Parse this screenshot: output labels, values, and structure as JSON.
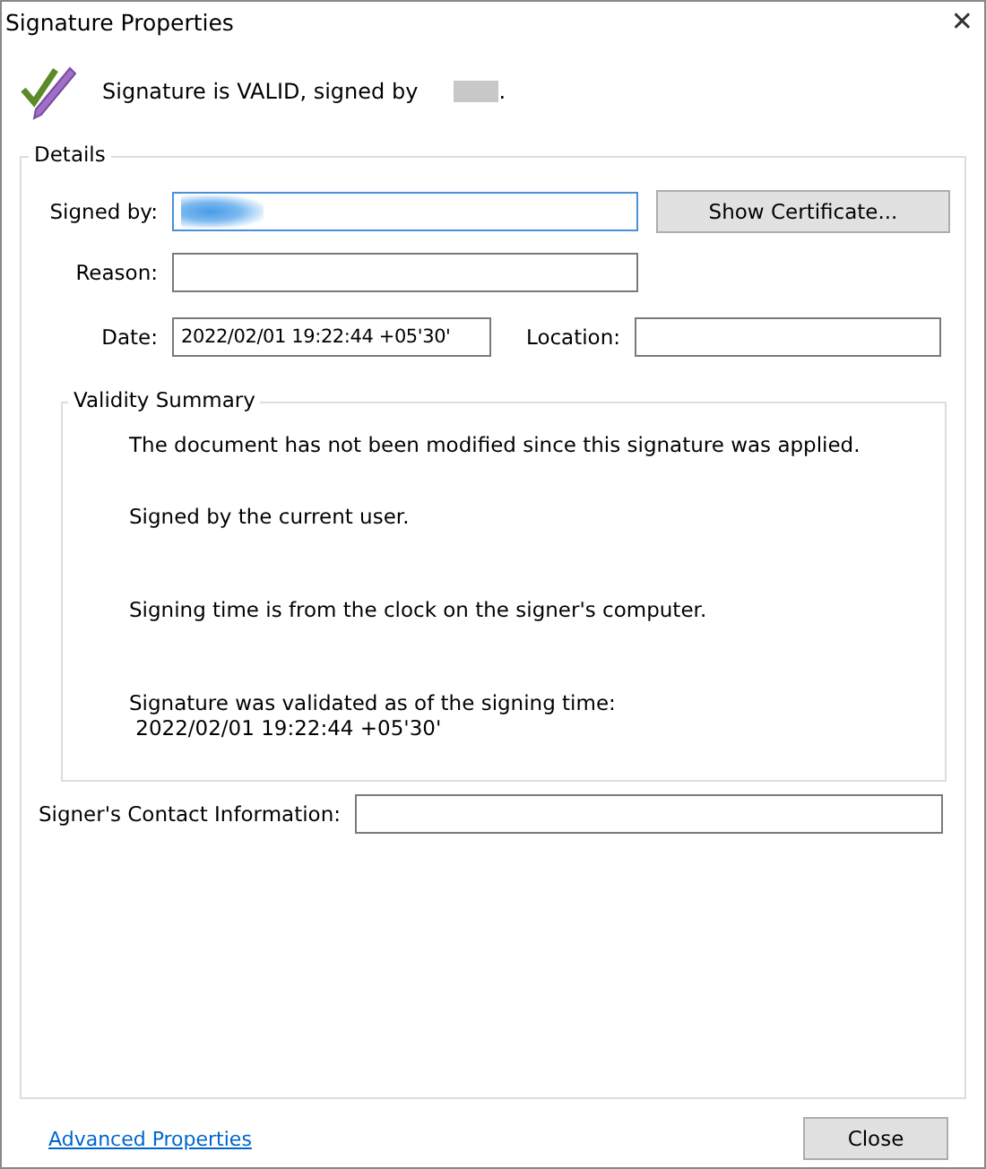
{
  "window": {
    "title": "Signature Properties",
    "close_glyph": "✕"
  },
  "header": {
    "message": "Signature is VALID, signed by",
    "message_end": "."
  },
  "details": {
    "title": "Details",
    "signed_by": {
      "label": "Signed by:",
      "focused": true
    },
    "show_certificate": "Show Certificate...",
    "reason": {
      "label": "Reason:",
      "focused": false
    },
    "date": {
      "label": "Date:",
      "value": "2022/02/01 19:22:44 +05'30'",
      "focused": false
    },
    "location": {
      "label": "Location:",
      "focused": false
    },
    "validity_summary": {
      "title": "Validity Summary",
      "lines": [
        "The document has not been modified since this signature was applied.",
        "Signed by the current user.",
        "Signing time is from the clock on the signer's computer.",
        "Signature was validated as of the signing time:\n 2022/02/01 19:22:44 +05'30'"
      ]
    },
    "contact": {
      "label": "Signer's Contact Information:",
      "focused": false
    }
  },
  "footer": {
    "link": "Advanced Properties",
    "close_button": "Close"
  }
}
